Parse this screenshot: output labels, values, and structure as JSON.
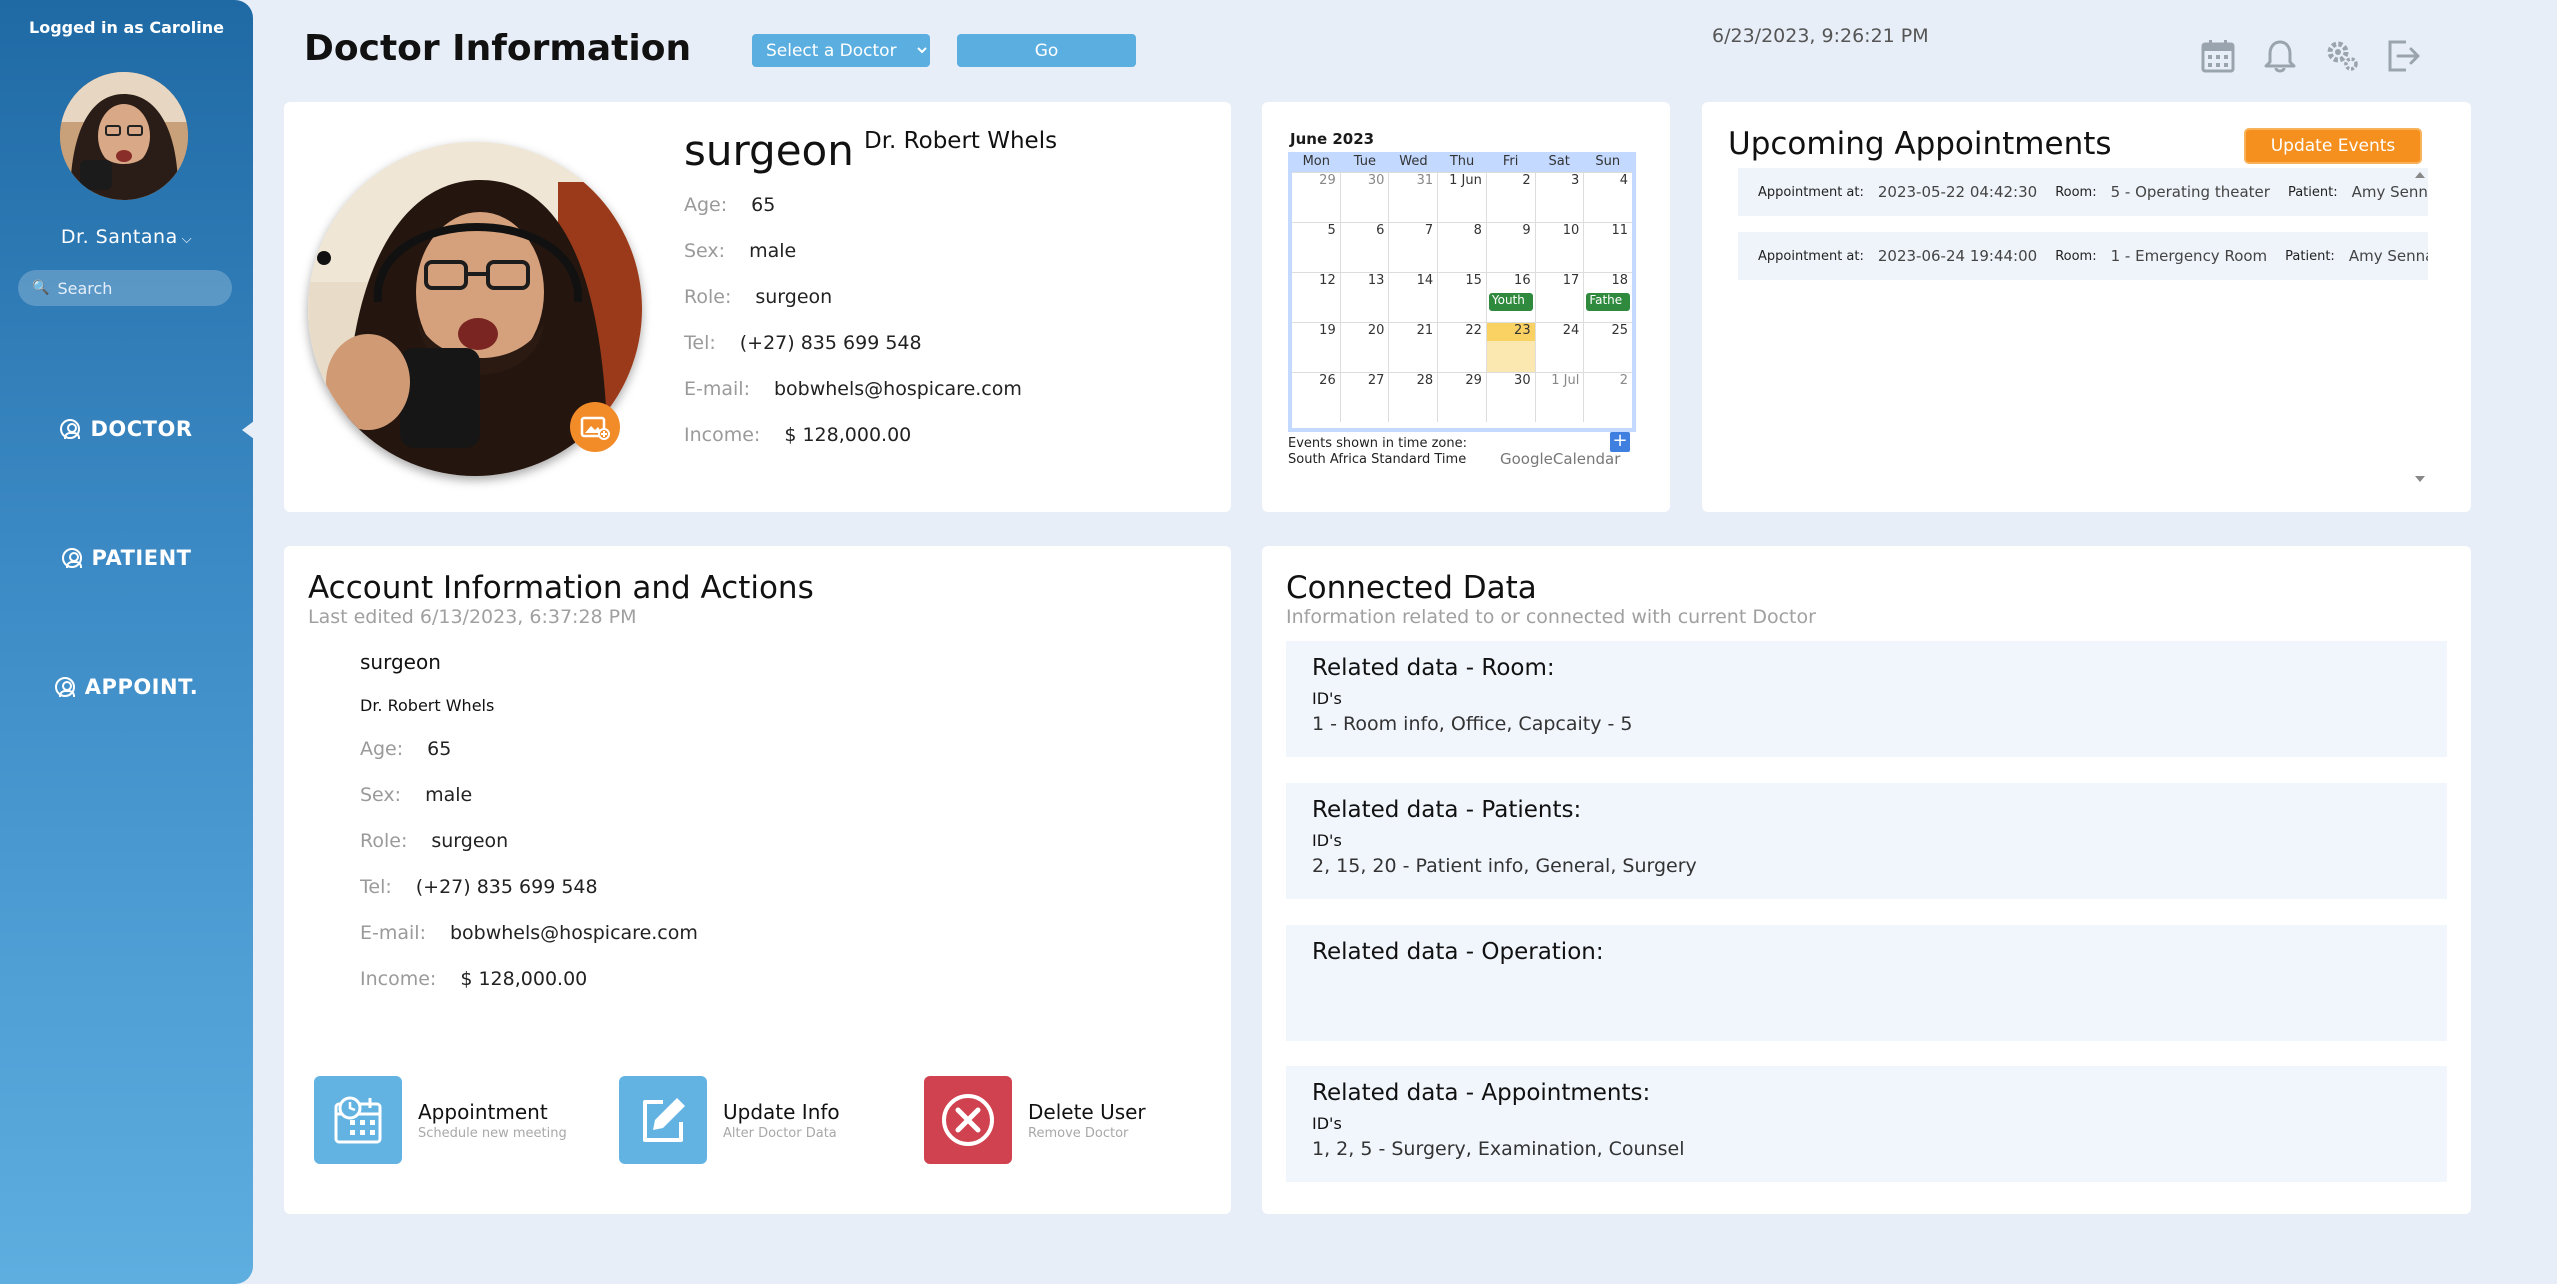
{
  "sidebar": {
    "logged_in": "Logged in as Caroline",
    "user_name": "Dr. Santana",
    "search_placeholder": "Search",
    "nav": [
      {
        "label": "DOCTOR"
      },
      {
        "label": "PATIENT"
      },
      {
        "label": "APPOINT."
      }
    ]
  },
  "header": {
    "title": "Doctor Information",
    "select_label": "Select a Doctor",
    "go_label": "Go",
    "datetime": "6/23/2023, 9:26:21 PM",
    "icons": [
      "calendar-icon",
      "bell-icon",
      "settings-icon",
      "logout-icon"
    ]
  },
  "profile": {
    "role": "surgeon",
    "name": "Dr. Robert Whels",
    "fields": [
      {
        "label": "Age:",
        "value": "65"
      },
      {
        "label": "Sex:",
        "value": "male"
      },
      {
        "label": "Role:",
        "value": "surgeon"
      },
      {
        "label": "Tel:",
        "value": "(+27) 835 699 548"
      },
      {
        "label": "E-mail:",
        "value": "bobwhels@hospicare.com"
      },
      {
        "label": "Income:",
        "value": "$ 128,000.00"
      }
    ]
  },
  "calendar": {
    "month": "June 2023",
    "weekdays": [
      "Mon",
      "Tue",
      "Wed",
      "Thu",
      "Fri",
      "Sat",
      "Sun"
    ],
    "weeks": [
      [
        "29",
        "30",
        "31",
        "1 Jun",
        "2",
        "3",
        "4"
      ],
      [
        "5",
        "6",
        "7",
        "8",
        "9",
        "10",
        "11"
      ],
      [
        "12",
        "13",
        "14",
        "15",
        "16",
        "17",
        "18"
      ],
      [
        "19",
        "20",
        "21",
        "22",
        "23",
        "24",
        "25"
      ],
      [
        "26",
        "27",
        "28",
        "29",
        "30",
        "1 Jul",
        "2"
      ]
    ],
    "events": [
      {
        "label": "Youth"
      },
      {
        "label": "Fathe"
      }
    ],
    "footer_line1": "Events shown in time zone:",
    "footer_line2": "South Africa Standard Time",
    "brand_google": "Google",
    "brand_calendar": "Calendar",
    "today_color": "#fad163",
    "event_color": "#2f8a3e"
  },
  "upcoming": {
    "title": "Upcoming Appointments",
    "update_label": "Update Events",
    "appointments": [
      {
        "at_label": "Appointment at:",
        "at": "2023-05-22 04:42:30",
        "room_label": "Room:",
        "room": "5 - Operating theater",
        "patient_label": "Patient:",
        "patient": "Amy Sennar"
      },
      {
        "at_label": "Appointment at:",
        "at": "2023-06-24 19:44:00",
        "room_label": "Room:",
        "room": "1 - Emergency Room",
        "patient_label": "Patient:",
        "patient": "Amy Sennar"
      }
    ]
  },
  "account": {
    "title": "Account Information and Actions",
    "last_edited": "Last edited 6/13/2023, 6:37:28 PM",
    "role": "surgeon",
    "name": "Dr. Robert Whels",
    "fields": [
      {
        "label": "Age:",
        "value": "65"
      },
      {
        "label": "Sex:",
        "value": "male"
      },
      {
        "label": "Role:",
        "value": "surgeon"
      },
      {
        "label": "Tel:",
        "value": "(+27) 835 699 548"
      },
      {
        "label": "E-mail:",
        "value": "bobwhels@hospicare.com"
      },
      {
        "label": "Income:",
        "value": "$ 128,000.00"
      }
    ],
    "actions": [
      {
        "label": "Appointment",
        "sub": "Schedule new meeting",
        "color": "#62b3e2"
      },
      {
        "label": "Update Info",
        "sub": "Alter Doctor Data",
        "color": "#62b3e2"
      },
      {
        "label": "Delete User",
        "sub": "Remove Doctor",
        "color": "#d0424f"
      }
    ]
  },
  "connected": {
    "title": "Connected Data",
    "subtitle": "Information related to or connected with current Doctor",
    "sections": [
      {
        "title": "Related data - Room:",
        "ids_label": "ID's",
        "value": "1 - Room info, Office, Capcaity - 5"
      },
      {
        "title": "Related data - Patients:",
        "ids_label": "ID's",
        "value": "2, 15, 20 - Patient info, General, Surgery"
      },
      {
        "title": "Related data - Operation:",
        "ids_label": "",
        "value": ""
      },
      {
        "title": "Related data - Appointments:",
        "ids_label": "ID's",
        "value": "1, 2, 5 - Surgery, Examination, Counsel"
      }
    ]
  },
  "colors": {
    "sidebar_top": "#1f6aa5",
    "sidebar_bottom": "#5eaee0",
    "accent": "#5aaee0",
    "update_button": "#f5901e",
    "background": "#e8eef8"
  }
}
